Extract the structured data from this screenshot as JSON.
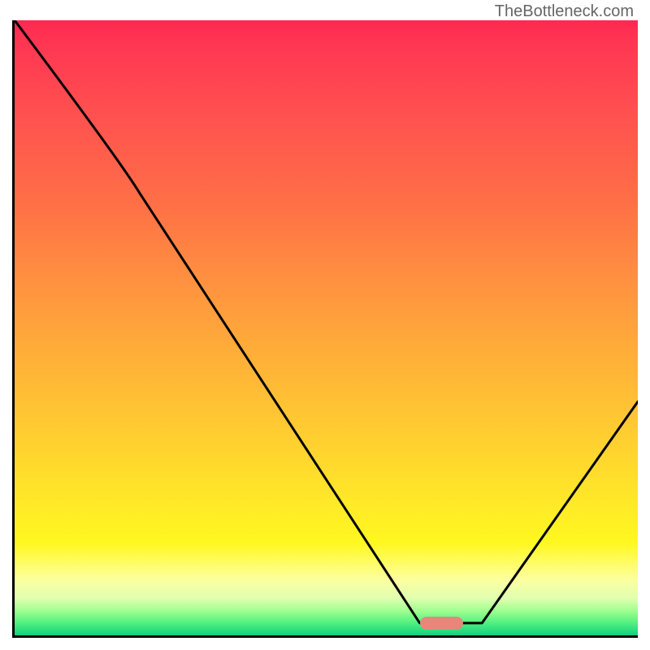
{
  "watermark": "TheBottleneck.com",
  "chart_data": {
    "type": "line",
    "title": "",
    "xlabel": "",
    "ylabel": "",
    "xlim": [
      0,
      100
    ],
    "ylim": [
      0,
      100
    ],
    "x": [
      0,
      20,
      65,
      75,
      100
    ],
    "values": [
      100,
      72,
      2,
      2,
      38
    ],
    "marker": {
      "x_start": 65,
      "x_end": 72,
      "y": 2
    },
    "gradient_stops": [
      {
        "pos": 0,
        "color": "#ff2850"
      },
      {
        "pos": 50,
        "color": "#ffb038"
      },
      {
        "pos": 85,
        "color": "#fff820"
      },
      {
        "pos": 100,
        "color": "#10d080"
      }
    ]
  }
}
